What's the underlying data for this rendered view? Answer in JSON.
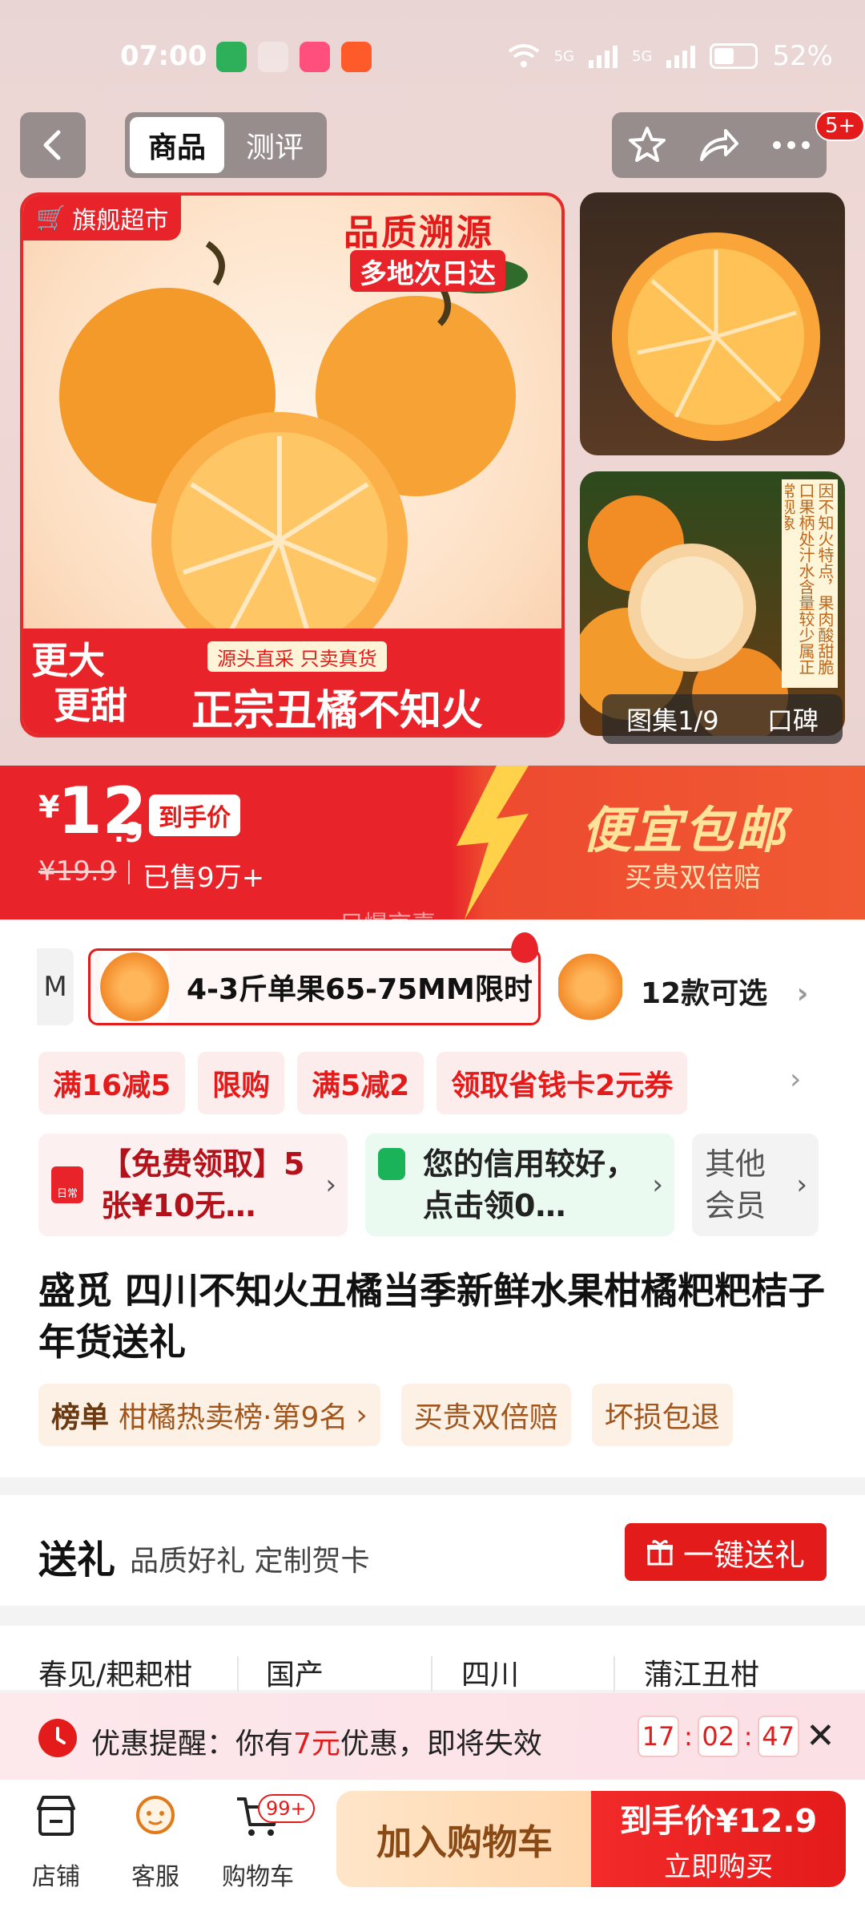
{
  "status": {
    "time": "07:00",
    "battery": "52%",
    "signal_a": "5G",
    "signal_b": "5G"
  },
  "nav": {
    "tab_product": "商品",
    "tab_review": "测评",
    "badge": "5+"
  },
  "gallery": {
    "store_label": "旗舰超市",
    "headline": "品质溯源",
    "subheadline": "多地次日达",
    "corner_line1": "更大",
    "corner_line2": "更甜",
    "ribbon": "源头直采 只卖真货",
    "banner": "正宗丑橘不知火",
    "thumb_side_text": "因不知火特点，果肉酸甜脆口果柄处汁水含量较少属正常现象",
    "counter": "图集1/9",
    "koubei": "口碑"
  },
  "price": {
    "yen": "¥",
    "integer": "12",
    "decimal": ".9",
    "tag": "到手价",
    "original": "¥19.9",
    "sold": "已售9万+",
    "promo_title": "便宜包邮",
    "promo_sub": "买贵双倍赔",
    "watermark": "只爆京喜"
  },
  "sku": {
    "left_stub": "M",
    "selected": "4-3斤单果65-75MM限时",
    "more": "12款可选"
  },
  "chips": [
    "满16减5",
    "限购",
    "满5减2",
    "领取省钱卡2元券"
  ],
  "cards": {
    "red_text": "【免费领取】5张¥10无…",
    "red_icon": "日常",
    "green_text": "您的信用较好，点击领0…",
    "grey_text": "其他会员"
  },
  "product": {
    "title": "盛觅 四川不知火丑橘当季新鲜水果柑橘粑粑桔子年货送礼"
  },
  "tags": {
    "rank_label": "榜单",
    "rank_text": "柑橘热卖榜·第9名",
    "tag2": "买贵双倍赔",
    "tag3": "坏损包退"
  },
  "gift": {
    "title": "送礼",
    "subtitle": "品质好礼 定制贺卡",
    "button": "一键送礼"
  },
  "attributes": [
    "春见/耙耙柑",
    "国产",
    "四川",
    "蒲江丑柑"
  ],
  "reminder": {
    "prefix": "优惠提醒：你有",
    "amount": "7元",
    "suffix": "优惠，即将失效",
    "hh": "17",
    "mm": "02",
    "ss": "47"
  },
  "bottom": {
    "store": "店铺",
    "service": "客服",
    "cart": "购物车",
    "cart_badge": "99+",
    "add_cart": "加入购物车",
    "buy_line1": "到手价¥12.9",
    "buy_line2": "立即购买"
  },
  "colors": {
    "brand_red": "#e41b1b",
    "promo_gold": "#ffe39a",
    "cart_button": "#ffd7ad"
  }
}
